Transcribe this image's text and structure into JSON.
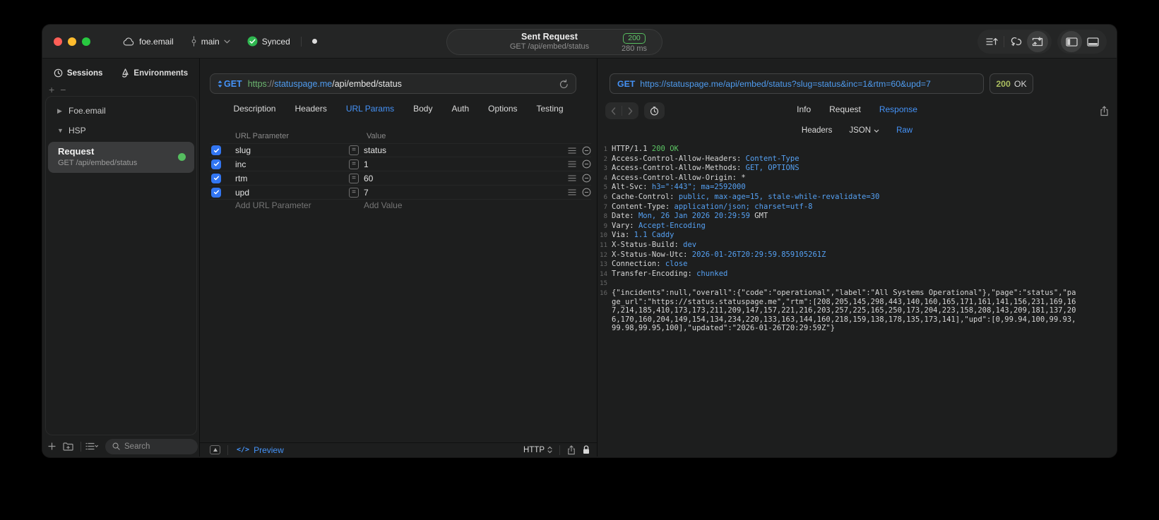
{
  "colors": {
    "accent_blue": "#4593f8",
    "url_host_blue": "#4f9cf0",
    "url_scheme_green": "#6cb570",
    "checkbox_blue": "#3276f2",
    "sync_green": "#2fb750",
    "badge_green": "#63c76c",
    "status_olive": "#aabd5f",
    "code_value_blue": "#55a0f2",
    "code_green": "#5cc564",
    "traffic_red": "#ff5f57",
    "traffic_yellow": "#febc2e",
    "traffic_green": "#28c840"
  },
  "titlebar": {
    "project": "foe.email",
    "branch": "main",
    "sync_status": "Synced",
    "center": {
      "title": "Sent Request",
      "subtitle": "GET /api/embed/status",
      "status_code": "200",
      "time": "280 ms"
    },
    "right_icons": [
      "sort-lines-up-icon",
      "linked-loop-icon",
      "import-response-icon",
      "toggle-sidebar-icon",
      "toggle-bottom-panel-icon"
    ]
  },
  "sidebar": {
    "tabs": [
      {
        "label": "Sessions",
        "icon": "history-clock-icon"
      },
      {
        "label": "Environments",
        "icon": "layers-icon"
      }
    ],
    "tree": [
      {
        "label": "Foe.email",
        "state": "collapsed"
      },
      {
        "label": "HSP",
        "state": "expanded"
      }
    ],
    "request_item": {
      "title": "Request",
      "subtitle": "GET /api/embed/status",
      "indicator": "green-dot"
    },
    "footer_icons": [
      "plus-icon",
      "new-folder-icon",
      "list-options-icon"
    ],
    "search_placeholder": "Search"
  },
  "request_pane": {
    "method": "GET",
    "url": {
      "scheme": "https",
      "sep": "://",
      "host": "statuspage.me",
      "path": "/api/embed/status"
    },
    "tabs": [
      "Description",
      "Headers",
      "URL Params",
      "Body",
      "Auth",
      "Options",
      "Testing"
    ],
    "active_tab": "URL Params",
    "table": {
      "headers": [
        "URL Parameter",
        "Value"
      ],
      "rows": [
        {
          "name": "slug",
          "value": "status",
          "checked": true
        },
        {
          "name": "inc",
          "value": "1",
          "checked": true
        },
        {
          "name": "rtm",
          "value": "60",
          "checked": true
        },
        {
          "name": "upd",
          "value": "7",
          "checked": true
        }
      ],
      "add_name_placeholder": "Add URL Parameter",
      "add_value_placeholder": "Add Value"
    },
    "footer": {
      "preview_label": "Preview",
      "code_glyph": "</>",
      "protocol": "HTTP"
    }
  },
  "response_pane": {
    "method": "GET",
    "url": "https://statuspage.me/api/embed/status?slug=status&inc=1&rtm=60&upd=7",
    "status_code": "200",
    "status_text": "OK",
    "tabs": [
      "Info",
      "Request",
      "Response"
    ],
    "active_tab": "Response",
    "subtabs": [
      "Headers",
      "JSON",
      "Raw"
    ],
    "active_subtab": "Raw",
    "lines": [
      {
        "n": "1",
        "segs": [
          {
            "c": "p",
            "t": "HTTP/1.1 "
          },
          {
            "c": "g",
            "t": "200 OK"
          }
        ]
      },
      {
        "n": "2",
        "segs": [
          {
            "c": "p",
            "t": "Access-Control-Allow-Headers: "
          },
          {
            "c": "b",
            "t": "Content-Type"
          }
        ]
      },
      {
        "n": "3",
        "segs": [
          {
            "c": "p",
            "t": "Access-Control-Allow-Methods: "
          },
          {
            "c": "b",
            "t": "GET, OPTIONS"
          }
        ]
      },
      {
        "n": "4",
        "segs": [
          {
            "c": "p",
            "t": "Access-Control-Allow-Origin: "
          },
          {
            "c": "p",
            "t": "*"
          }
        ]
      },
      {
        "n": "5",
        "segs": [
          {
            "c": "p",
            "t": "Alt-Svc: "
          },
          {
            "c": "b",
            "t": "h3=\":443\"; ma=2592000"
          }
        ]
      },
      {
        "n": "6",
        "segs": [
          {
            "c": "p",
            "t": "Cache-Control: "
          },
          {
            "c": "b",
            "t": "public, max-age=15, stale-while-revalidate=30"
          }
        ]
      },
      {
        "n": "7",
        "segs": [
          {
            "c": "p",
            "t": "Content-Type: "
          },
          {
            "c": "b",
            "t": "application/json; charset=utf-8"
          }
        ]
      },
      {
        "n": "8",
        "segs": [
          {
            "c": "p",
            "t": "Date: "
          },
          {
            "c": "b",
            "t": "Mon, 26 Jan 2026 20:29:59"
          },
          {
            "c": "p",
            "t": " GMT"
          }
        ]
      },
      {
        "n": "9",
        "segs": [
          {
            "c": "p",
            "t": "Vary: "
          },
          {
            "c": "b",
            "t": "Accept-Encoding"
          }
        ]
      },
      {
        "n": "10",
        "segs": [
          {
            "c": "p",
            "t": "Via: "
          },
          {
            "c": "b",
            "t": "1.1 Caddy"
          }
        ]
      },
      {
        "n": "11",
        "segs": [
          {
            "c": "p",
            "t": "X-Status-Build: "
          },
          {
            "c": "b",
            "t": "dev"
          }
        ]
      },
      {
        "n": "12",
        "segs": [
          {
            "c": "p",
            "t": "X-Status-Now-Utc: "
          },
          {
            "c": "b",
            "t": "2026-01-26T20:29:59.859105261Z"
          }
        ]
      },
      {
        "n": "13",
        "segs": [
          {
            "c": "p",
            "t": "Connection: "
          },
          {
            "c": "b",
            "t": "close"
          }
        ]
      },
      {
        "n": "14",
        "segs": [
          {
            "c": "p",
            "t": "Transfer-Encoding: "
          },
          {
            "c": "b",
            "t": "chunked"
          }
        ]
      },
      {
        "n": "15",
        "segs": []
      },
      {
        "n": "16",
        "segs": [
          {
            "c": "p",
            "t": "{\"incidents\":null,\"overall\":{\"code\":\"operational\",\"label\":\"All Systems Operational\"},\"page\":\"status\",\"page_url\":\"https://status.statuspage.me\",\"rtm\":[208,205,145,298,443,140,160,165,171,161,141,156,231,169,167,214,185,410,173,173,211,209,147,157,221,216,203,257,225,165,250,173,204,223,158,208,143,209,181,137,206,170,160,204,149,154,134,234,220,133,163,144,160,218,159,138,178,135,173,141],\"upd\":[0,99.94,100,99.93,99.98,99.95,100],\"updated\":\"2026-01-26T20:29:59Z\"}"
          }
        ]
      }
    ]
  }
}
